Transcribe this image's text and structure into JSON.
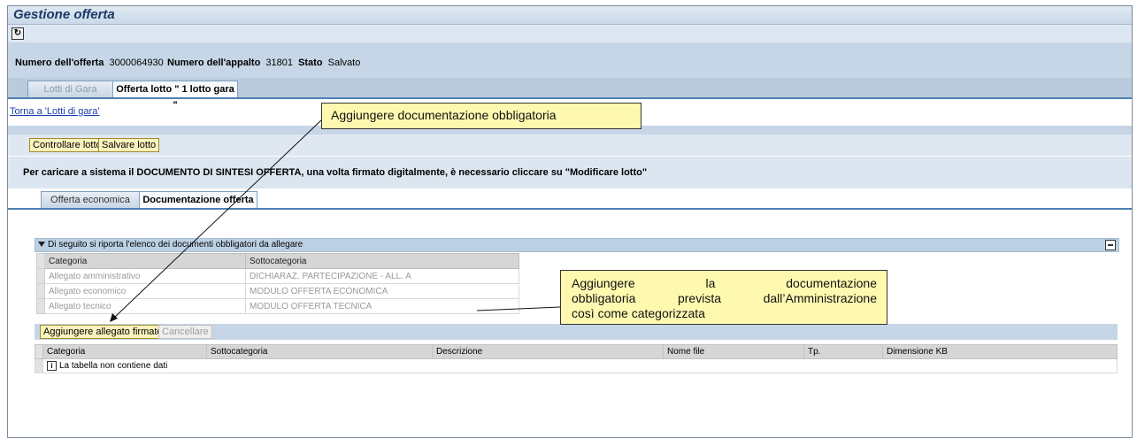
{
  "window": {
    "title": "Gestione offerta"
  },
  "header": {
    "offer_label": "Numero dell'offerta",
    "offer_value": "3000064930",
    "tender_label": "Numero dell'appalto",
    "tender_value": "31801",
    "state_label": "Stato",
    "state_value": "Salvato"
  },
  "tabs_main": [
    "Lotti di Gara",
    "Offerta lotto \" 1 lotto gara \""
  ],
  "back_link": "Torna a 'Lotti di gara'",
  "toolbar": {
    "check_label": "Controllare lotto",
    "save_label": "Salvare lotto"
  },
  "info_message": "Per caricare a sistema il DOCUMENTO DI SINTESI OFFERTA, una volta firmato digitalmente, è necessario cliccare su \"Modificare lotto\"",
  "tabs_sub": [
    "Offerta economica",
    "Documentazione offerta"
  ],
  "required_docs": {
    "title": "Di seguito si riporta l'elenco dei documenti obbligatori da allegare",
    "columns": [
      "Categoria",
      "Sottocategoria"
    ],
    "rows": [
      [
        "Allegato amministrativo",
        "DICHIARAZ. PARTECIPAZIONE - ALL. A"
      ],
      [
        "Allegato economico",
        "MODULO OFFERTA ECONOMICA"
      ],
      [
        "Allegato tecnico",
        "MODULO OFFERTA TECNICA"
      ]
    ]
  },
  "attachments": {
    "add_label": "Aggiungere allegato firmato",
    "delete_label": "Cancellare",
    "columns": [
      "Categoria",
      "Sottocategoria",
      "Descrizione",
      "Nome file",
      "Tp.",
      "Dimensione KB"
    ],
    "empty_text": "La tabella non contiene dati"
  },
  "callouts": {
    "top": "Aggiungere documentazione obbligatoria",
    "side_lines": [
      "Aggiungere la documentazione",
      "obbligatoria prevista dall’Amministrazione",
      "così come categorizzata"
    ]
  },
  "colors": {
    "tab_border": "#4f7fb0",
    "callout_bg": "#fff9b0",
    "button_bg": "#fbf3bf"
  }
}
